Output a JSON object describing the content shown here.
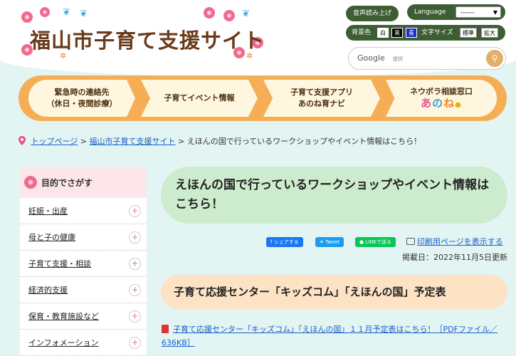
{
  "header": {
    "site_title": "福山市子育て支援サイト",
    "voice_label": "音声読み上げ",
    "language_label": "Language",
    "language_selected": "------",
    "bg_color_label": "背景色",
    "bg_white": "白",
    "bg_black": "黒",
    "bg_blue": "青",
    "font_size_label": "文字サイズ",
    "font_standard": "標準",
    "font_large": "拡大",
    "search_brand": "Google",
    "search_placeholder": "提供"
  },
  "nav": [
    {
      "line1": "緊急時の連絡先",
      "line2": "（休日・夜間診療）"
    },
    {
      "line1": "子育てイベント情報",
      "line2": ""
    },
    {
      "line1": "子育て支援アプリ",
      "line2": "あのね育ナビ"
    },
    {
      "line1": "ネウボラ相談窓口",
      "logo_a": "あ",
      "logo_n": "の",
      "logo_e": "ね"
    }
  ],
  "breadcrumb": {
    "top": "トップページ",
    "sep": ">",
    "site": "福山市子育て支援サイト",
    "current": "えほんの国で行っているワークショップやイベント情報はこちら！"
  },
  "sidebar": {
    "heading": "目的でさがす",
    "items": [
      {
        "label": "妊娠・出産"
      },
      {
        "label": "母と子の健康"
      },
      {
        "label": "子育て支援・相談"
      },
      {
        "label": "経済的支援"
      },
      {
        "label": "保育・教育施設など"
      },
      {
        "label": "インフォメーション"
      }
    ]
  },
  "main": {
    "title": "えほんの国で行っているワークショップやイベント情報はこちら！",
    "share_facebook": "シェアする",
    "share_twitter": "Tweet",
    "share_line": "LINEで送る",
    "print_label": "印刷用ページを表示する",
    "posted_date": "掲載日：2022年11月5日更新",
    "section_heading": "子育て応援センター「キッズコム」「えほんの国」予定表",
    "pdf_link": "子育て応援センター「キッズコム」「えほんの国」１１月予定表はこちら！［PDFファイル／636KB］"
  },
  "colors": {
    "accent_orange": "#f5ae55",
    "title_green": "#cdeccd",
    "section_peach": "#fde3c4",
    "link_blue": "#1a5ec8",
    "toolbar_green": "#3d5e33"
  }
}
